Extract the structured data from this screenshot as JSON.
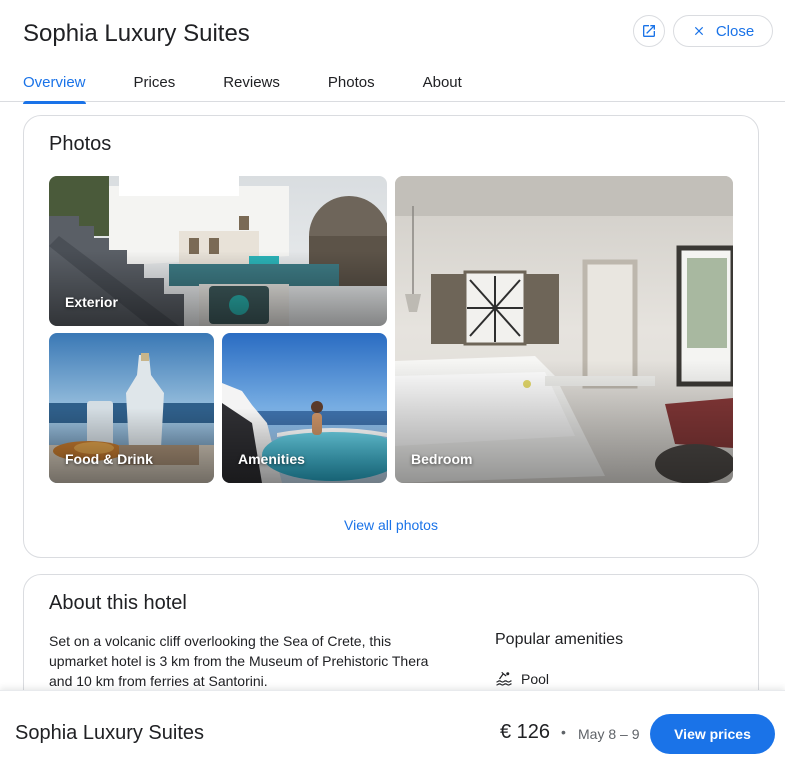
{
  "header": {
    "hotel_name": "Sophia Luxury Suites",
    "close_label": "Close",
    "open_icon": "open-in-new-icon",
    "close_icon": "close-icon"
  },
  "tabs": [
    {
      "label": "Overview",
      "active": true
    },
    {
      "label": "Prices",
      "active": false
    },
    {
      "label": "Reviews",
      "active": false
    },
    {
      "label": "Photos",
      "active": false
    },
    {
      "label": "About",
      "active": false
    }
  ],
  "photos": {
    "title": "Photos",
    "items": [
      {
        "label": "Exterior"
      },
      {
        "label": "Food & Drink"
      },
      {
        "label": "Amenities"
      },
      {
        "label": "Bedroom"
      }
    ],
    "view_all": "View all photos"
  },
  "about": {
    "title": "About this hotel",
    "description": "Set on a volcanic cliff overlooking the Sea of Crete, this upmarket hotel is 3 km from the Museum of Prehistoric Thera and 10 km from ferries at Santorini.",
    "amenities_title": "Popular amenities",
    "amenities": [
      {
        "icon": "pool-icon",
        "label": "Pool"
      }
    ]
  },
  "bottom_bar": {
    "hotel_name": "Sophia Luxury Suites",
    "price": "€ 126",
    "separator": "•",
    "dates": "May 8 – 9",
    "button_label": "View prices"
  },
  "colors": {
    "accent": "#1a73e8",
    "border": "#dadce0",
    "text": "#202124",
    "muted": "#5f6368"
  }
}
